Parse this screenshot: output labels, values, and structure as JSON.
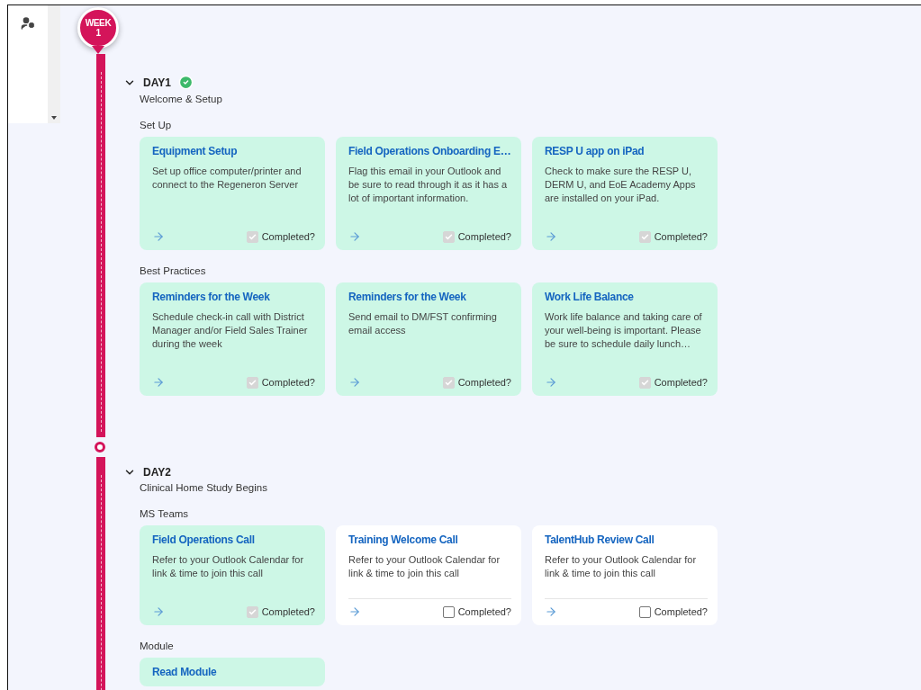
{
  "week": {
    "label": "WEEK",
    "number": "1"
  },
  "days": [
    {
      "title": "DAY1",
      "subtitle": "Welcome & Setup",
      "completed": true,
      "expanded": true,
      "groups": [
        {
          "name": "Set Up",
          "tasks": [
            {
              "title": "Equipment Setup",
              "description": "Set up office computer/printer and connect to the Regeneron Server",
              "completed": true,
              "completion_label": "Completed?"
            },
            {
              "title": "Field Operations Onboarding E…",
              "description": "Flag this email in your Outlook and be sure to read through it as it has a lot of important information.",
              "completed": true,
              "completion_label": "Completed?"
            },
            {
              "title": "RESP U app on iPad",
              "description": "Check to make sure the RESP U, DERM U, and EoE Academy Apps are installed on your iPad.",
              "completed": true,
              "completion_label": "Completed?"
            }
          ]
        },
        {
          "name": "Best Practices",
          "tasks": [
            {
              "title": "Reminders for the Week",
              "description": "Schedule check-in call with District Manager and/or Field Sales Trainer during the week",
              "completed": true,
              "completion_label": "Completed?"
            },
            {
              "title": "Reminders for the Week",
              "description": "Send email to DM/FST confirming email access",
              "completed": true,
              "completion_label": "Completed?"
            },
            {
              "title": "Work Life Balance",
              "description": "Work life balance and taking care of your well-being is important. Please be sure to schedule daily lunch…",
              "completed": true,
              "completion_label": "Completed?"
            }
          ]
        }
      ]
    },
    {
      "title": "DAY2",
      "subtitle": "Clinical Home Study Begins",
      "completed": false,
      "expanded": true,
      "groups": [
        {
          "name": "MS Teams",
          "tasks": [
            {
              "title": "Field Operations Call",
              "description": "Refer to your Outlook Calendar for link & time to join this call",
              "completed": true,
              "completion_label": "Completed?"
            },
            {
              "title": "Training Welcome Call",
              "description": "Refer to your Outlook Calendar for link & time to join this call",
              "completed": false,
              "completion_label": "Completed?"
            },
            {
              "title": "TalentHub Review Call",
              "description": "Refer to your Outlook Calendar for link & time to join this call",
              "completed": false,
              "completion_label": "Completed?"
            }
          ]
        },
        {
          "name": "Module",
          "tasks": [
            {
              "title": "Read Module",
              "completed": true
            }
          ]
        }
      ]
    }
  ]
}
